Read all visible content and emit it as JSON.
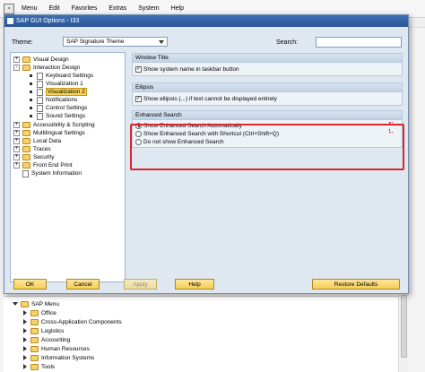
{
  "main_window": {
    "menu": [
      "Menu",
      "Edit",
      "Favorites",
      "Extras",
      "System",
      "Help"
    ],
    "tree": {
      "root": "SAP Menu",
      "items": [
        "Office",
        "Cross-Application Components",
        "Logistics",
        "Accounting",
        "Human Resources",
        "Information Systems",
        "Tools"
      ]
    }
  },
  "dialog": {
    "title": "SAP GUI Options - I33",
    "theme_label": "Theme:",
    "theme_value": "SAP Signature Theme",
    "search_label": "Search:",
    "search_value": "",
    "nav": [
      {
        "label": "Visual Design",
        "toggle": "+",
        "icon": "folder"
      },
      {
        "label": "Interaction Design",
        "toggle": "-",
        "icon": "folder-open"
      },
      {
        "label": "Keyboard Settings",
        "icon": "page"
      },
      {
        "label": "Visualization 1",
        "icon": "page"
      },
      {
        "label": "Visualization 2",
        "icon": "page",
        "selected": true
      },
      {
        "label": "Notifications",
        "icon": "page"
      },
      {
        "label": "Control Settings",
        "icon": "page"
      },
      {
        "label": "Sound Settings",
        "icon": "page"
      },
      {
        "label": "Accessibility & Scripting",
        "toggle": "+",
        "icon": "folder"
      },
      {
        "label": "Multilingual Settings",
        "toggle": "+",
        "icon": "folder"
      },
      {
        "label": "Local Data",
        "toggle": "+",
        "icon": "folder"
      },
      {
        "label": "Traces",
        "toggle": "+",
        "icon": "folder"
      },
      {
        "label": "Security",
        "toggle": "+",
        "icon": "folder"
      },
      {
        "label": "Front End Print",
        "toggle": "+",
        "icon": "folder"
      },
      {
        "label": "System Information",
        "icon": "page"
      }
    ],
    "groups": {
      "window_title": {
        "header": "Window Title",
        "option": "Show system name in taskbar button",
        "checked": true
      },
      "ellipsis": {
        "header": "Ellipsis",
        "option": "Show ellipsis (...) if text cannot be displayed entirely",
        "checked": true
      },
      "enhanced_search": {
        "header": "Enhanced Search",
        "options": [
          "Show Enhanced Search Automatically",
          "Show Enhanced Search with Shortcut (Ctrl+Shift+Q)",
          "Do not show Enhanced Search"
        ],
        "selected_index": 0
      }
    },
    "buttons": {
      "ok": "OK",
      "cancel": "Cancel",
      "apply": "Apply",
      "help": "Help",
      "restore": "Restore Defaults"
    },
    "colors": {
      "title_bar": "#2a5597",
      "selected_item": "#f7d35a",
      "highlight_box": "#d9262c",
      "button": "#f5cf52"
    }
  }
}
